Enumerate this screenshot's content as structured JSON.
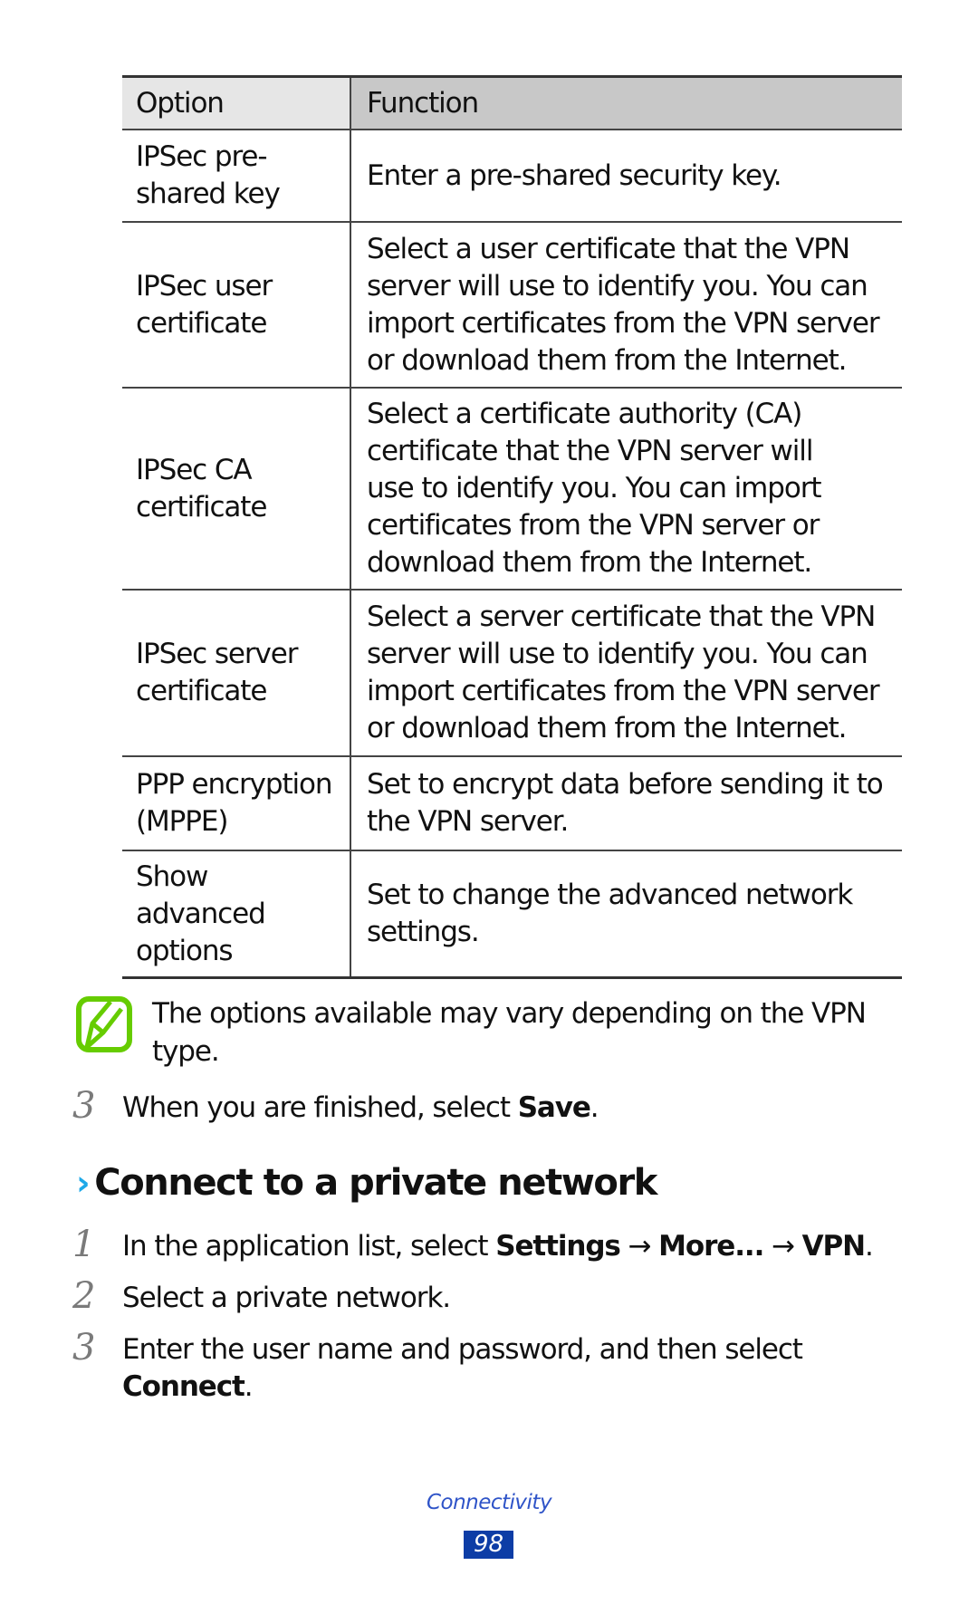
{
  "table": {
    "headers": {
      "option": "Option",
      "function": "Function"
    },
    "colors": {
      "header_option_bg": "#e6e6e6",
      "header_function_bg": "#c8c8c8"
    },
    "rows": [
      {
        "option": [
          "IPSec pre-",
          "shared key"
        ],
        "function": [
          "Enter a pre-shared security key."
        ]
      },
      {
        "option": [
          "IPSec user",
          "certificate"
        ],
        "function": [
          "Select a user certificate that the VPN",
          "server will use to identify you. You can",
          "import certificates from the VPN server",
          "or download them from the Internet."
        ]
      },
      {
        "option": [
          "IPSec CA",
          "certificate"
        ],
        "function": [
          "Select a certificate authority (CA)",
          "certificate that the VPN server will",
          "use to identify you. You can import",
          "certificates from the VPN server or",
          "download them from the Internet."
        ]
      },
      {
        "option": [
          "IPSec server",
          "certificate"
        ],
        "function": [
          "Select a server certificate that the VPN",
          "server will use to identify you. You can",
          "import certificates from the VPN server",
          "or download them from the Internet."
        ]
      },
      {
        "option": [
          "PPP encryption",
          "(MPPE)"
        ],
        "function": [
          "Set to encrypt data before sending it to",
          "the VPN server."
        ]
      },
      {
        "option": [
          "Show",
          "advanced",
          "options"
        ],
        "function": [
          "Set to change the advanced network",
          "settings."
        ]
      }
    ]
  },
  "note": {
    "icon": "note-pencil-icon",
    "icon_color": "#66cc00",
    "lines": [
      "The options available may vary depending on the VPN",
      "type."
    ]
  },
  "step_save": {
    "number": "3",
    "text_before": "When you are finished, select ",
    "bold": "Save",
    "text_after": "."
  },
  "section": {
    "chevron": "›",
    "chevron_color": "#1fa9e8",
    "title": "Connect to a private network",
    "steps": [
      {
        "number": "1",
        "parts": [
          {
            "text": "In the application list, select ",
            "bold": false
          },
          {
            "text": "Settings",
            "bold": true
          },
          {
            "text": " → ",
            "bold": false
          },
          {
            "text": "More...",
            "bold": true
          },
          {
            "text": " → ",
            "bold": false
          },
          {
            "text": "VPN",
            "bold": true
          },
          {
            "text": ".",
            "bold": false
          }
        ]
      },
      {
        "number": "2",
        "text": "Select a private network."
      },
      {
        "number": "3",
        "line1": "Enter the user name and password, and then select",
        "bold": "Connect",
        "after": "."
      }
    ]
  },
  "footer": {
    "label": "Connectivity",
    "page": "98",
    "label_color": "#2f54c8",
    "page_bg": "#0d3da6"
  }
}
